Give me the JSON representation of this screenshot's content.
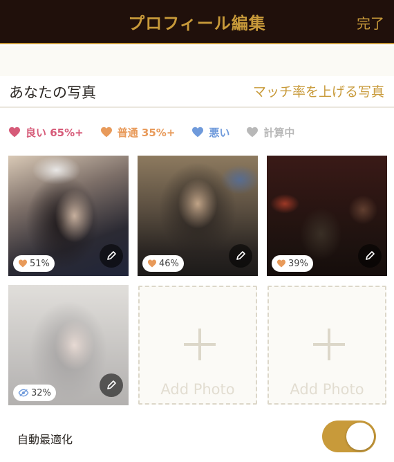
{
  "header": {
    "title": "プロフィール編集",
    "done_label": "完了"
  },
  "section": {
    "label": "あなたの写真",
    "link": "マッチ率を上げる写真"
  },
  "legend": [
    {
      "label": "良い 65%+",
      "color": "#d65a78",
      "icon": "heart-icon"
    },
    {
      "label": "普通 35%+",
      "color": "#e89a5a",
      "icon": "heart-icon"
    },
    {
      "label": "悪い",
      "color": "#6f9adb",
      "icon": "heart-icon"
    },
    {
      "label": "計算中",
      "color": "#b8b8b8",
      "icon": "heart-icon"
    }
  ],
  "photos": [
    {
      "score": "51%",
      "badge_icon": "heart-icon",
      "badge_color": "#e89a5a"
    },
    {
      "score": "46%",
      "badge_icon": "heart-icon",
      "badge_color": "#e89a5a"
    },
    {
      "score": "39%",
      "badge_icon": "heart-icon",
      "badge_color": "#e89a5a"
    },
    {
      "score": "32%",
      "badge_icon": "eye-slash-icon",
      "badge_color": "#6f9adb"
    }
  ],
  "add_photo": {
    "label": "Add Photo",
    "slots": 2
  },
  "auto_optimize": {
    "label": "自動最適化",
    "enabled": true,
    "color": "#c89a3a"
  },
  "colors": {
    "header_bg": "#20100b",
    "accent": "#c89a3a"
  }
}
